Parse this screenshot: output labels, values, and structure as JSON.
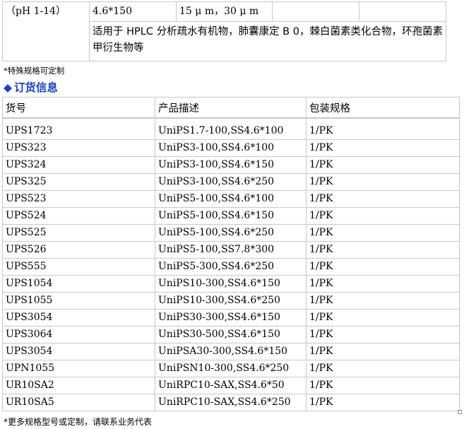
{
  "spec_table": {
    "ph": "（pH 1-14）",
    "dimension": "4.6*150",
    "particle_size": "15 μ m，30 μ m",
    "blank1": "",
    "blank2": "",
    "description": "适用于 HPLC 分析疏水有机物，肺囊康定 B 0，棘白菌素类化合物，环孢菌素甲衍生物等"
  },
  "note_custom": "*特殊规格可定制",
  "order_section": {
    "diamond": "◆",
    "title": "订货信息"
  },
  "order_table": {
    "headers": [
      "货号",
      "产品描述",
      "包装规格"
    ],
    "rows": [
      [
        "UPS1723",
        "UniPS1.7-100,SS4.6*100",
        "1/PK"
      ],
      [
        "UPS323",
        "UniPS3-100,SS4.6*100",
        "1/PK"
      ],
      [
        "UPS324",
        "UniPS3-100,SS4.6*150",
        "1/PK"
      ],
      [
        "UPS325",
        "UniPS3-100,SS4.6*250",
        "1/PK"
      ],
      [
        "UPS523",
        "UniPS5-100,SS4.6*100",
        "1/PK"
      ],
      [
        "UPS524",
        "UniPS5-100,SS4.6*150",
        "1/PK"
      ],
      [
        "UPS525",
        "UniPS5-100,SS4.6*250",
        "1/PK"
      ],
      [
        "UPS526",
        "UniPS5-100,SS7.8*300",
        "1/PK"
      ],
      [
        "UPS555",
        "UniPS5-300,SS4.6*250",
        "1/PK"
      ],
      [
        "UPS1054",
        "UniPS10-300,SS4.6*150",
        "1/PK"
      ],
      [
        "UPS1055",
        "UniPS10-300,SS4.6*250",
        "1/PK"
      ],
      [
        "UPS3054",
        "UniPS30-300,SS4.6*150",
        "1/PK"
      ],
      [
        "UPS3064",
        "UniPS30-500,SS4.6*150",
        "1/PK"
      ],
      [
        "UPS3054",
        "UniPSA30-300,SS4.6*150",
        "1/PK"
      ],
      [
        "UPN1055",
        "UniPSN10-300,SS4.6*250",
        "1/PK"
      ],
      [
        "UR10SA2",
        "UniRPC10-SAX,SS4.6*50",
        "1/PK"
      ],
      [
        "UR10SA5",
        "UniRPC10-SAX,SS4.6*250",
        "1/PK"
      ]
    ]
  },
  "note_more": "*更多规格型号或定制，请联系业务代表"
}
